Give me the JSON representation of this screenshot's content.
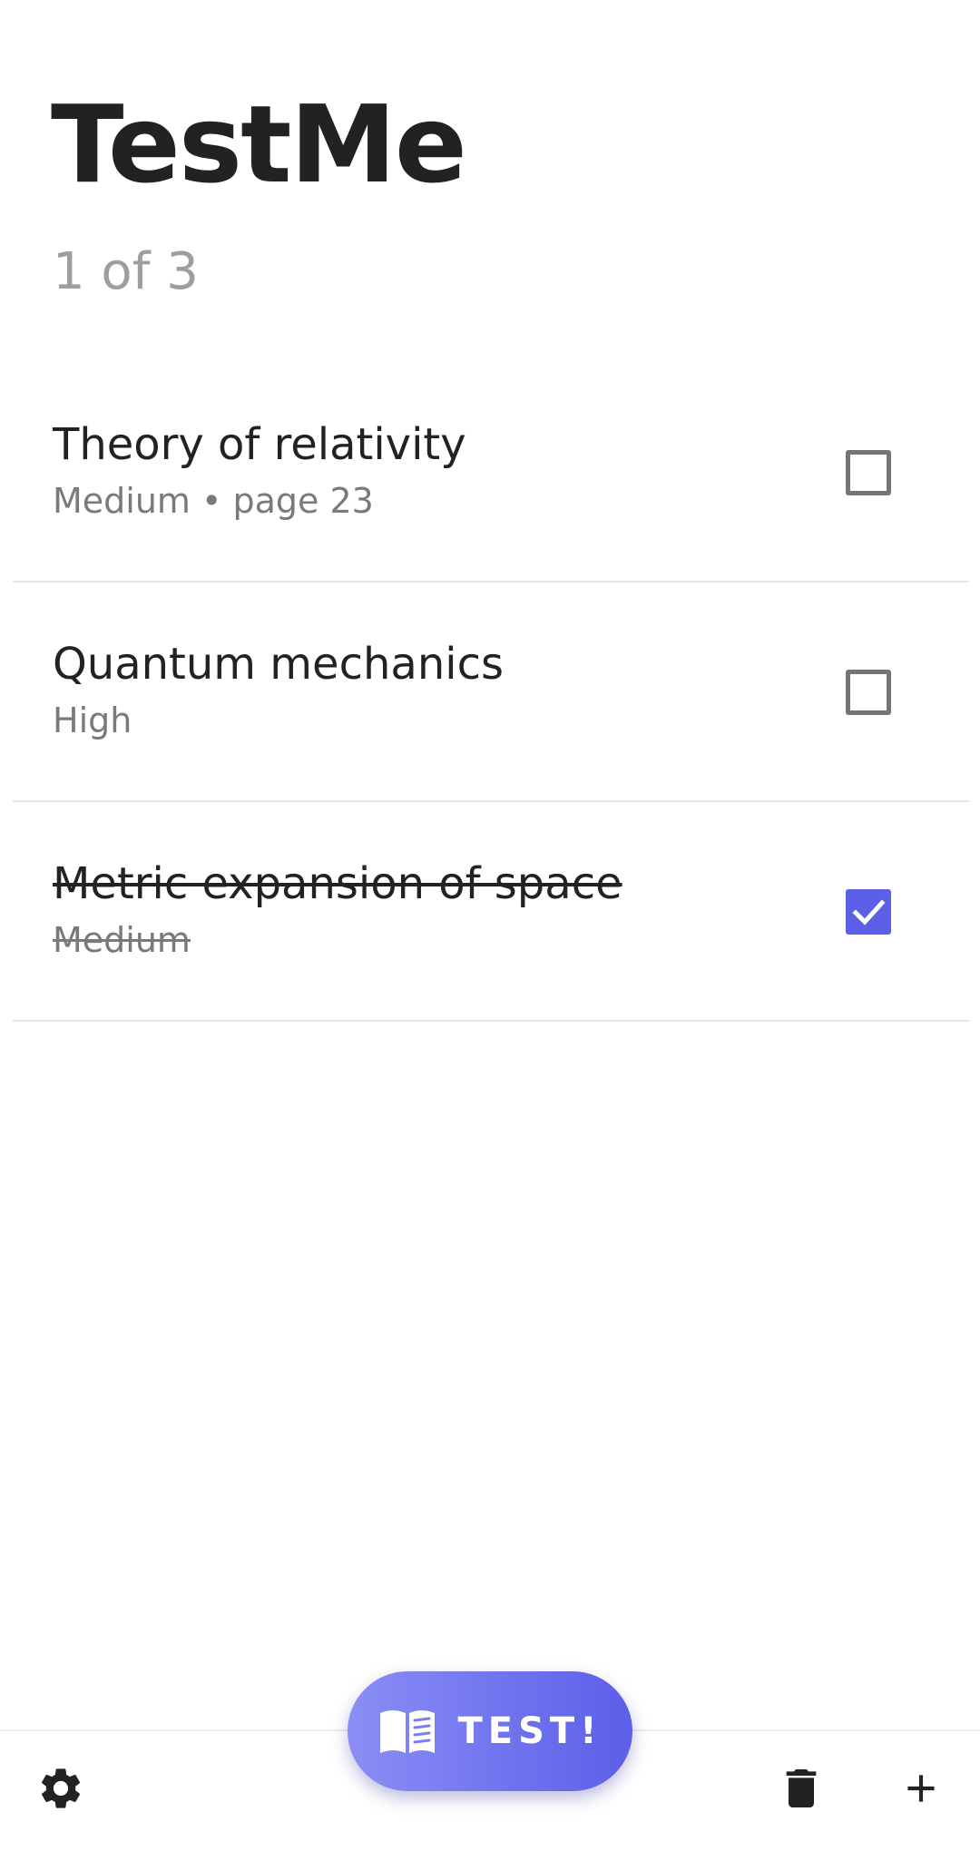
{
  "header": {
    "title": "TestMe",
    "progress": "1 of 3"
  },
  "tasks": [
    {
      "title": "Theory of relativity",
      "meta": "Medium • page 23",
      "checked": false
    },
    {
      "title": "Quantum mechanics",
      "meta": "High",
      "checked": false
    },
    {
      "title": "Metric expansion of space",
      "meta": "Medium",
      "checked": true
    }
  ],
  "fab": {
    "label": "TEST!",
    "icon": "book-icon"
  },
  "bottom_bar": {
    "settings_icon": "gear-icon",
    "delete_icon": "trash-icon",
    "add_icon": "plus-icon"
  },
  "colors": {
    "accent": "#5c5fe8",
    "accent_light": "#8a8ef5",
    "title_text": "#222222",
    "secondary_text": "#7a7a7a",
    "progress_text": "#9e9e9e",
    "unchecked_border": "#757575"
  }
}
